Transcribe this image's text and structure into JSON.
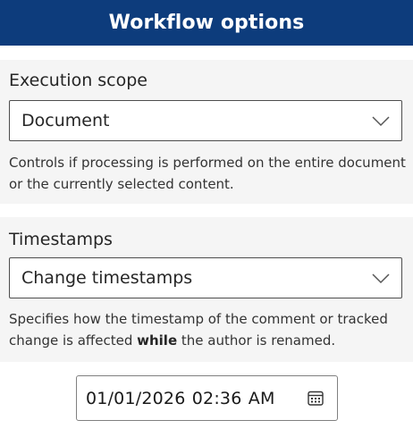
{
  "header": {
    "title": "Workflow options"
  },
  "execution_scope": {
    "label": "Execution scope",
    "selected": "Document",
    "help": "Controls if processing is performed on the entire document or the currently selected content."
  },
  "timestamps": {
    "label": "Timestamps",
    "selected": "Change timestamps",
    "help_before": "Specifies how the timestamp of the comment or tracked change is affected ",
    "help_bold": "while",
    "help_after": " the author is renamed."
  },
  "datetime": {
    "value": "01/01/2026  02:36  AM",
    "icon": "calendar-icon"
  },
  "colors": {
    "header_bg": "#0d3c7c",
    "section_bg": "#f5f5f5"
  }
}
